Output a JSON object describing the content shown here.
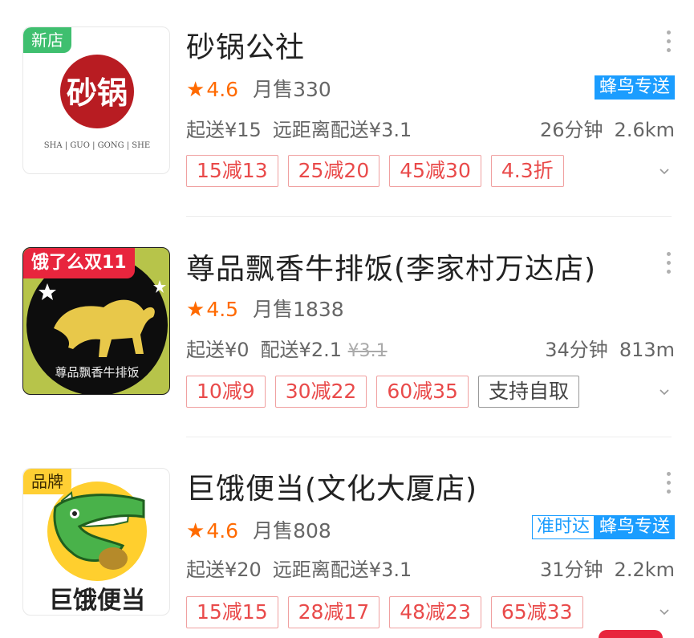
{
  "stores": [
    {
      "name": "砂锅公社",
      "corner_tag": "新店",
      "logo_text": "砂锅",
      "logo_subtext": "SHA | GUO | GONG | SHE",
      "rating": "4.6",
      "monthly_sales": "月售330",
      "badges": [
        "蜂鸟专送"
      ],
      "min_order": "起送¥15",
      "delivery_fee": "远距离配送¥3.1",
      "time": "26分钟",
      "distance": "2.6km",
      "promos": [
        "15减13",
        "25减20",
        "45减30",
        "4.3折"
      ]
    },
    {
      "name": "尊品飘香牛排饭(李家村万达店)",
      "corner_tag": "饿了么双11",
      "logo_text": "尊品飘香牛排饭",
      "rating": "4.5",
      "monthly_sales": "月售1838",
      "badges": [],
      "min_order": "起送¥0",
      "delivery_fee": "配送¥2.1",
      "delivery_fee_original": "¥3.1",
      "time": "34分钟",
      "distance": "813m",
      "promos": [
        "10减9",
        "30减22",
        "60减35"
      ],
      "extra_promo": "支持自取"
    },
    {
      "name": "巨饿便当(文化大厦店)",
      "corner_tag": "品牌",
      "logo_text": "巨饿便当",
      "rating": "4.6",
      "monthly_sales": "月售808",
      "badges": [
        "准时达",
        "蜂鸟专送"
      ],
      "min_order": "起送¥20",
      "delivery_fee": "远距离配送¥3.1",
      "time": "31分钟",
      "distance": "2.2km",
      "promos": [
        "15减15",
        "28减17",
        "48减23",
        "65减33"
      ]
    }
  ],
  "icons": {
    "star": "★",
    "more": "more-vertical-icon",
    "chevron": "chevron-down-icon"
  },
  "colors": {
    "accent": "#ff6a00",
    "promo_red": "#e94a4a",
    "fengniao_blue": "#1b9dff"
  }
}
